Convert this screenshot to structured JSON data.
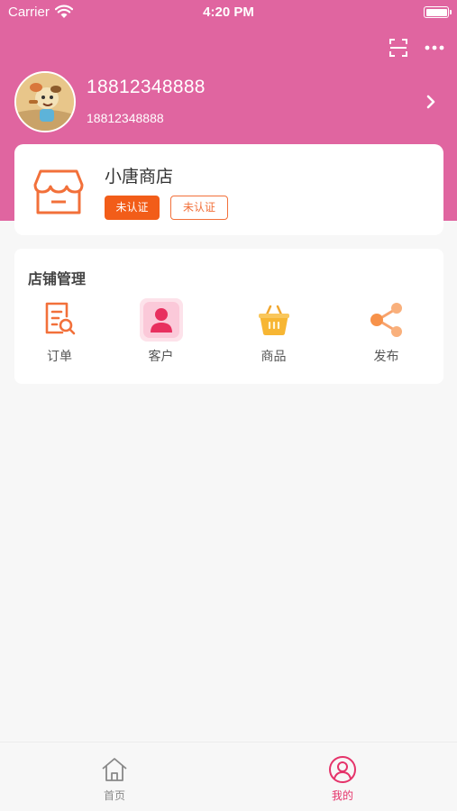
{
  "status_bar": {
    "carrier": "Carrier",
    "time": "4:20 PM"
  },
  "header": {
    "actions": [
      "scan-icon",
      "more-icon"
    ]
  },
  "profile": {
    "name": "18812348888",
    "phone": "18812348888"
  },
  "shop": {
    "name": "小唐商店",
    "badges": [
      "未认证",
      "未认证"
    ]
  },
  "management": {
    "title": "店铺管理",
    "items": [
      {
        "label": "订单",
        "icon": "order-search-icon"
      },
      {
        "label": "客户",
        "icon": "customer-icon"
      },
      {
        "label": "商品",
        "icon": "basket-icon"
      },
      {
        "label": "发布",
        "icon": "share-icon"
      }
    ]
  },
  "tabbar": {
    "items": [
      {
        "label": "首页",
        "icon": "home-icon",
        "active": false
      },
      {
        "label": "我的",
        "icon": "user-circle-icon",
        "active": true
      }
    ]
  },
  "colors": {
    "header": "#e065a0",
    "accent": "#f25d19",
    "active_tab": "#e5336a"
  }
}
